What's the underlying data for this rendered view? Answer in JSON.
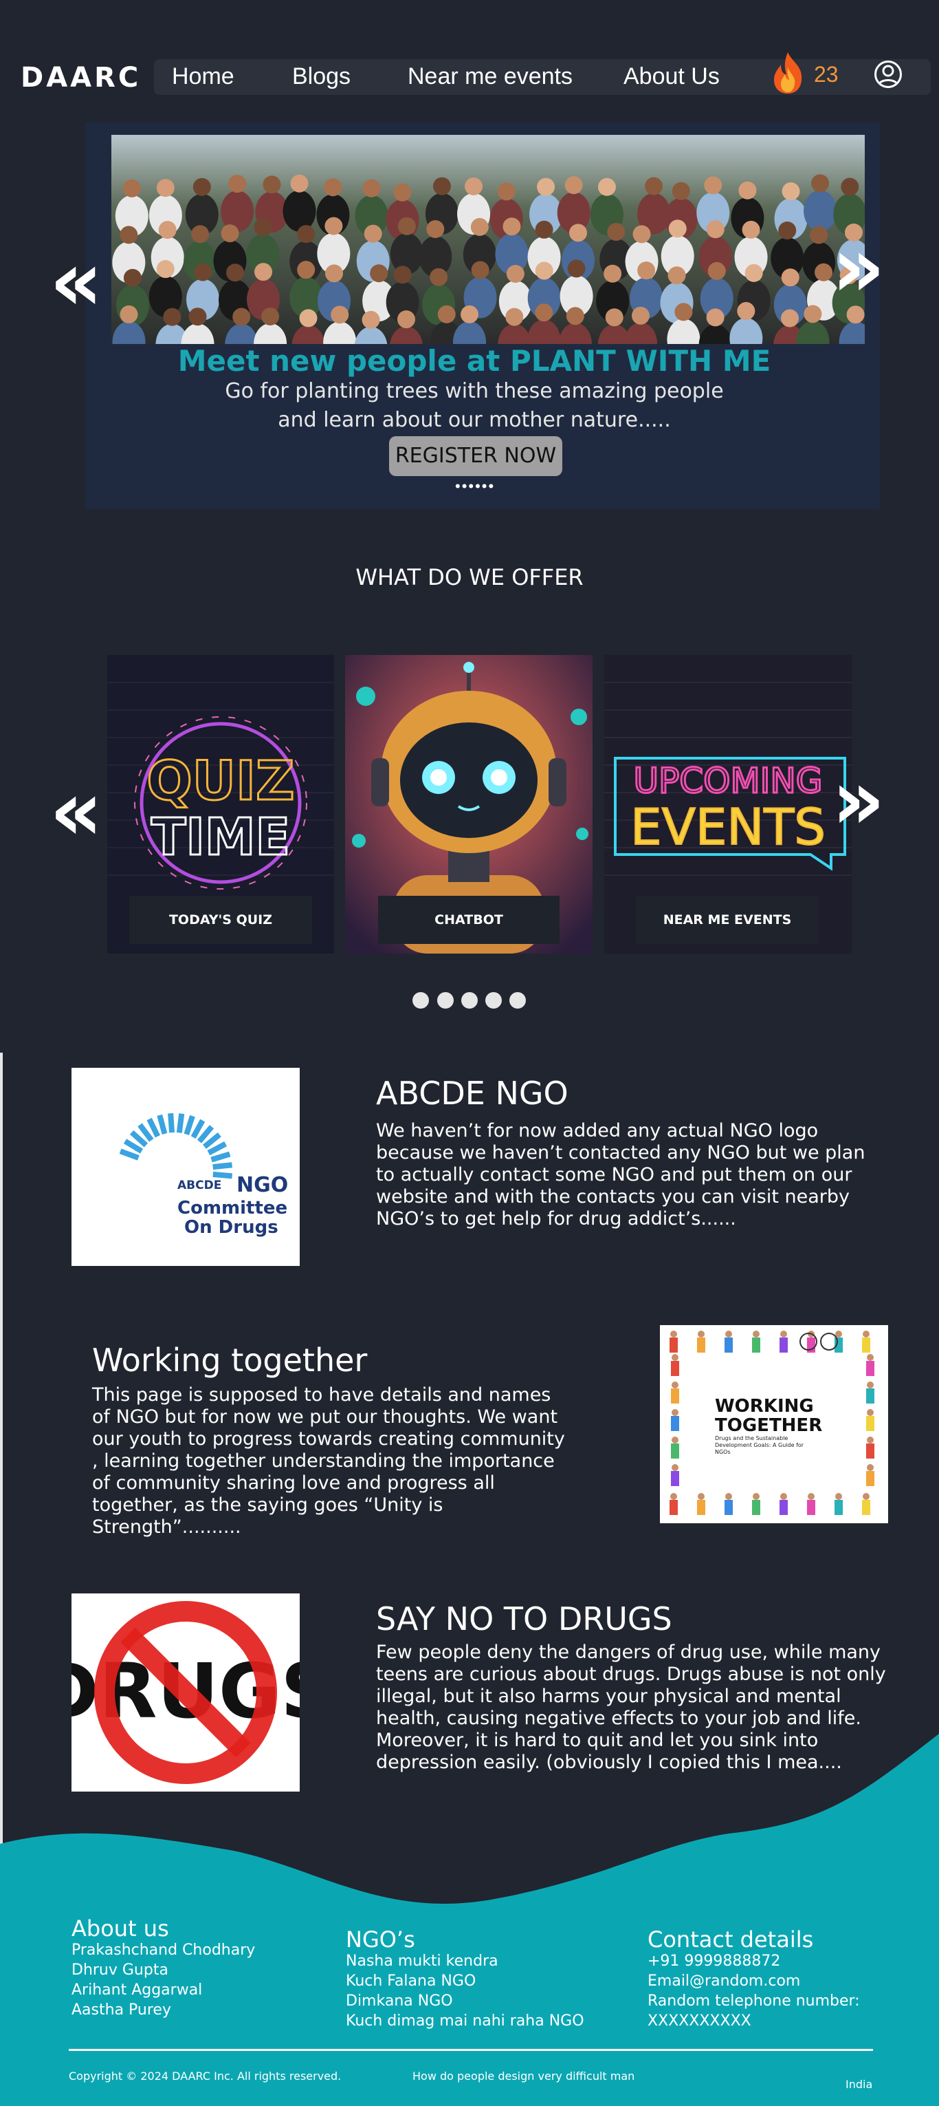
{
  "brand": {
    "logo": "DAARC"
  },
  "nav": {
    "items": [
      "Home",
      "Blogs",
      "Near me events",
      "About Us"
    ],
    "streak_count": "23"
  },
  "hero": {
    "title": "Meet new people at PLANT WITH ME",
    "desc_line1": "Go for planting trees with these amazing people",
    "desc_line2": "and learn about our mother nature.....",
    "register": "REGISTER NOW",
    "dots": "••••••"
  },
  "offer": {
    "title": "WHAT DO WE OFFER",
    "cards": [
      {
        "button": "TODAY'S QUIZ",
        "art_line1": "QUIZ",
        "art_line2": "TIME"
      },
      {
        "button": "CHATBOT"
      },
      {
        "button": "NEAR ME EVENTS",
        "art_line1": "UPCOMING",
        "art_line2": "EVENTS"
      }
    ]
  },
  "sections": [
    {
      "title": "ABCDE NGO",
      "body": "We haven’t for now added any actual NGO logo because we haven’t contacted any NGO but we plan to actually contact some NGO and put them on our website and with the contacts you can visit nearby NGO’s to get help for drug addict’s......",
      "logo_text1": "ABCDE",
      "logo_text2": "NGO",
      "logo_text3": "Committee",
      "logo_text4": "On Drugs"
    },
    {
      "title": "Working together",
      "body": "This page is supposed to have details and names of NGO but for now we put our thoughts. We want our youth to progress towards creating community , learning together understanding the importance of community sharing love and progress all together, as the saying goes “Unity is Strength”..........",
      "image_title1": "WORKING",
      "image_title2": "TOGETHER",
      "image_sub": "Drugs and the Sustainable Development Goals: A Guide for NGOs"
    },
    {
      "title": "SAY NO TO DRUGS",
      "body": "Few people deny the dangers of drug use, while many teens are curious about drugs. Drugs abuse is not only illegal, but it also harms your physical and mental health, causing negative effects to your job and life. Moreover, it is hard to quit and let you sink into depression easily. (obviously I copied this I mea....",
      "image_text": "DRUGS"
    }
  ],
  "footer": {
    "about": {
      "title": "About us",
      "items": [
        "Prakashchand Chodhary",
        "Dhruv Gupta",
        "Arihant Aggarwal",
        "Aastha Purey"
      ]
    },
    "ngos": {
      "title": "NGO’s",
      "items": [
        "Nasha mukti kendra",
        "Kuch Falana NGO",
        "Dimkana NGO",
        "Kuch dimag mai nahi raha NGO"
      ]
    },
    "contact": {
      "title": "Contact details",
      "items": [
        "+91 9999888872",
        "Email@random.com",
        "Random telephone number:",
        "XXXXXXXXXX"
      ]
    },
    "copyright": "Copyright © 2024 DAARC Inc. All rights reserved.",
    "tagline": "How do people design very difficult man",
    "country": "India"
  },
  "colors": {
    "background": "#21252f",
    "accent": "#1aa5b2",
    "hero_bg": "#1f2a40",
    "streak": "#f3963a"
  }
}
